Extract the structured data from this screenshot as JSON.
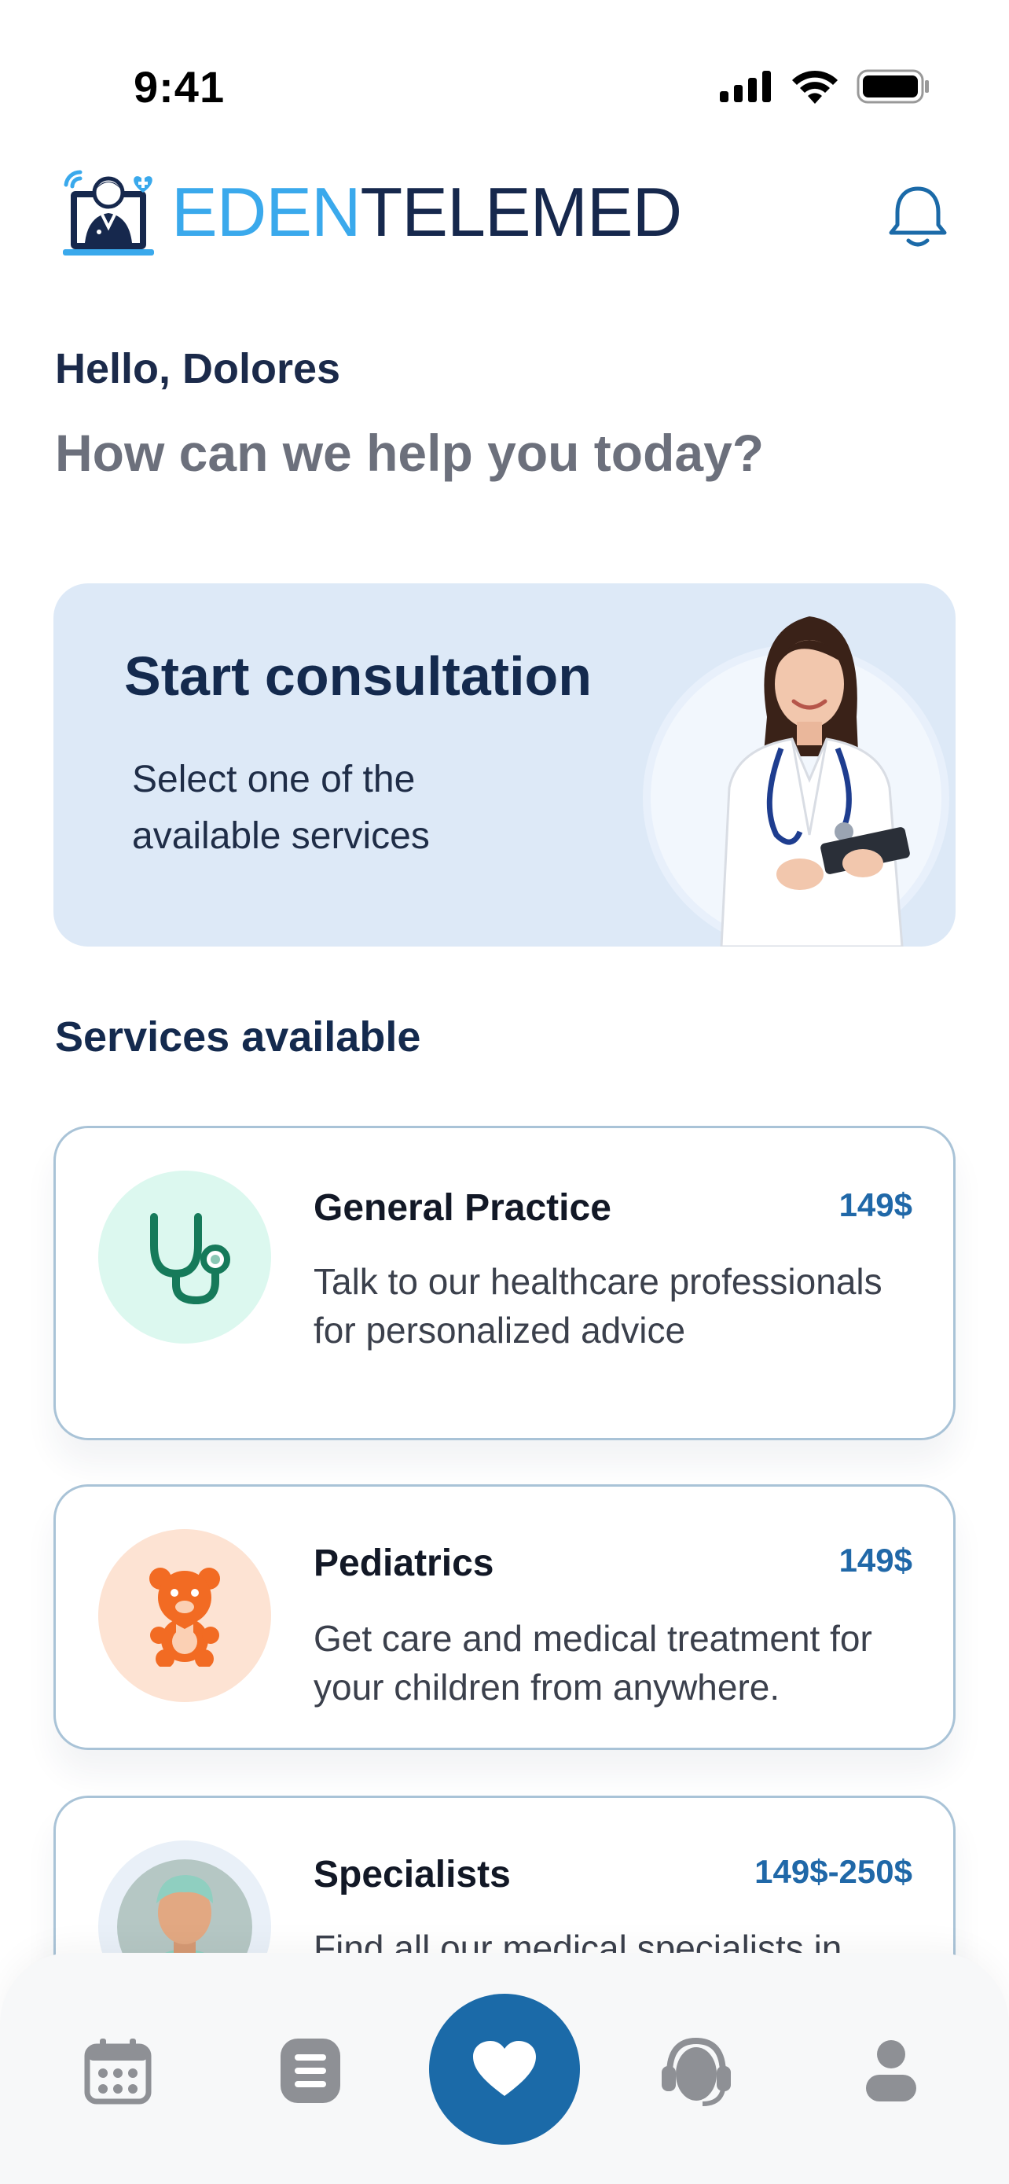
{
  "status_bar": {
    "time": "9:41"
  },
  "header": {
    "brand_part1": "EDEN",
    "brand_part2": "TELEMED"
  },
  "greeting": "Hello, Dolores",
  "prompt": "How can we help you today?",
  "consultation": {
    "title": "Start consultation",
    "subtitle": "Select one of the available services"
  },
  "services_title": "Services available",
  "services": [
    {
      "name": "General Practice",
      "price": "149$",
      "description": "Talk to our healthcare professionals for personalized advice",
      "icon": "stethoscope-icon"
    },
    {
      "name": "Pediatrics",
      "price": "149$",
      "description": "Get care and medical treatment for your children from anywhere.",
      "icon": "teddy-bear-icon"
    },
    {
      "name": "Specialists",
      "price": "149$-250$",
      "description": "Find all our medical specialists in",
      "icon": "specialist-avatar"
    }
  ],
  "nav": {
    "items": [
      "calendar-icon",
      "records-icon",
      "heart-icon",
      "support-icon",
      "profile-icon"
    ],
    "active": "heart-icon"
  },
  "colors": {
    "primary": "#1b6aa8",
    "brand_light": "#3aa9ec",
    "brand_dark": "#16284d",
    "card_bg": "#dde9f7"
  }
}
